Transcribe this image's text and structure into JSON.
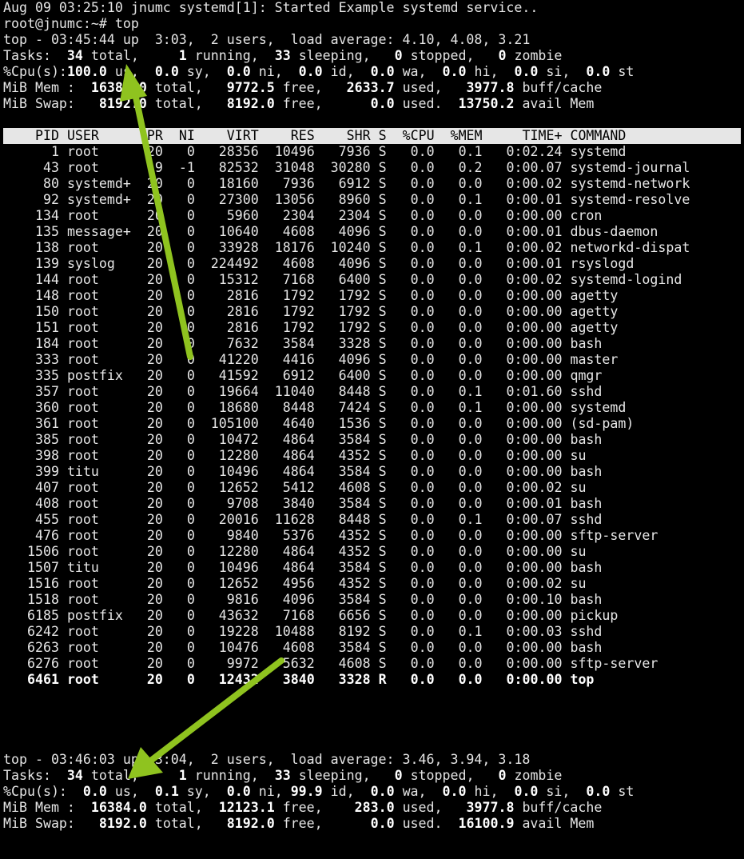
{
  "log_line": "Aug 09 03:25:10 jnumc systemd[1]: Started Example systemd service..",
  "prompt_line": "root@jnumc:~# top",
  "first": {
    "uptime": "top - 03:45:44 up  3:03,  2 users,  load average: 4.10, 4.08, 3.21",
    "tasks": {
      "total": "34",
      "running": "1",
      "sleeping": "33",
      "stopped": "0",
      "zombie": "0"
    },
    "cpu": {
      "us": "100.0",
      "sy": "0.0",
      "ni": "0.0",
      "id": "0.0",
      "wa": "0.0",
      "hi": "0.0",
      "si": "0.0",
      "st": "0.0"
    },
    "mem": {
      "total": "16384.0",
      "free": "9772.5",
      "used": "2633.7",
      "buff": "3977.8"
    },
    "swap": {
      "total": "8192.0",
      "free": "8192.0",
      "used": "0.0",
      "avail": "13750.2"
    }
  },
  "columns": {
    "pid": "PID",
    "user": "USER",
    "pr": "PR",
    "ni": "NI",
    "virt": "VIRT",
    "res": "RES",
    "shr": "SHR",
    "s": "S",
    "cpu": "%CPU",
    "mem": "%MEM",
    "time": "TIME+",
    "command": "COMMAND"
  },
  "processes": [
    [
      "1",
      "root",
      "20",
      "0",
      "28356",
      "10496",
      "7936",
      "S",
      "0.0",
      "0.1",
      "0:02.24",
      "systemd"
    ],
    [
      "43",
      "root",
      "19",
      "-1",
      "82532",
      "31048",
      "30280",
      "S",
      "0.0",
      "0.2",
      "0:00.07",
      "systemd-journal"
    ],
    [
      "80",
      "systemd+",
      "20",
      "0",
      "18160",
      "7936",
      "6912",
      "S",
      "0.0",
      "0.0",
      "0:00.02",
      "systemd-network"
    ],
    [
      "92",
      "systemd+",
      "20",
      "0",
      "27300",
      "13056",
      "8960",
      "S",
      "0.0",
      "0.1",
      "0:00.01",
      "systemd-resolve"
    ],
    [
      "134",
      "root",
      "20",
      "0",
      "5960",
      "2304",
      "2304",
      "S",
      "0.0",
      "0.0",
      "0:00.00",
      "cron"
    ],
    [
      "135",
      "message+",
      "20",
      "0",
      "10640",
      "4608",
      "4096",
      "S",
      "0.0",
      "0.0",
      "0:00.01",
      "dbus-daemon"
    ],
    [
      "138",
      "root",
      "20",
      "0",
      "33928",
      "18176",
      "10240",
      "S",
      "0.0",
      "0.1",
      "0:00.02",
      "networkd-dispat"
    ],
    [
      "139",
      "syslog",
      "20",
      "0",
      "224492",
      "4608",
      "4096",
      "S",
      "0.0",
      "0.0",
      "0:00.01",
      "rsyslogd"
    ],
    [
      "144",
      "root",
      "20",
      "0",
      "15312",
      "7168",
      "6400",
      "S",
      "0.0",
      "0.0",
      "0:00.02",
      "systemd-logind"
    ],
    [
      "148",
      "root",
      "20",
      "0",
      "2816",
      "1792",
      "1792",
      "S",
      "0.0",
      "0.0",
      "0:00.00",
      "agetty"
    ],
    [
      "150",
      "root",
      "20",
      "0",
      "2816",
      "1792",
      "1792",
      "S",
      "0.0",
      "0.0",
      "0:00.00",
      "agetty"
    ],
    [
      "151",
      "root",
      "20",
      "0",
      "2816",
      "1792",
      "1792",
      "S",
      "0.0",
      "0.0",
      "0:00.00",
      "agetty"
    ],
    [
      "184",
      "root",
      "20",
      "0",
      "7632",
      "3584",
      "3328",
      "S",
      "0.0",
      "0.0",
      "0:00.00",
      "bash"
    ],
    [
      "333",
      "root",
      "20",
      "0",
      "41220",
      "4416",
      "4096",
      "S",
      "0.0",
      "0.0",
      "0:00.00",
      "master"
    ],
    [
      "335",
      "postfix",
      "20",
      "0",
      "41592",
      "6912",
      "6400",
      "S",
      "0.0",
      "0.0",
      "0:00.00",
      "qmgr"
    ],
    [
      "357",
      "root",
      "20",
      "0",
      "19664",
      "11040",
      "8448",
      "S",
      "0.0",
      "0.1",
      "0:01.60",
      "sshd"
    ],
    [
      "360",
      "root",
      "20",
      "0",
      "18680",
      "8448",
      "7424",
      "S",
      "0.0",
      "0.1",
      "0:00.00",
      "systemd"
    ],
    [
      "361",
      "root",
      "20",
      "0",
      "105100",
      "4640",
      "1536",
      "S",
      "0.0",
      "0.0",
      "0:00.00",
      "(sd-pam)"
    ],
    [
      "385",
      "root",
      "20",
      "0",
      "10472",
      "4864",
      "3584",
      "S",
      "0.0",
      "0.0",
      "0:00.00",
      "bash"
    ],
    [
      "398",
      "root",
      "20",
      "0",
      "12280",
      "4864",
      "4352",
      "S",
      "0.0",
      "0.0",
      "0:00.00",
      "su"
    ],
    [
      "399",
      "titu",
      "20",
      "0",
      "10496",
      "4864",
      "3584",
      "S",
      "0.0",
      "0.0",
      "0:00.00",
      "bash"
    ],
    [
      "407",
      "root",
      "20",
      "0",
      "12652",
      "5412",
      "4608",
      "S",
      "0.0",
      "0.0",
      "0:00.02",
      "su"
    ],
    [
      "408",
      "root",
      "20",
      "0",
      "9708",
      "3840",
      "3584",
      "S",
      "0.0",
      "0.0",
      "0:00.01",
      "bash"
    ],
    [
      "455",
      "root",
      "20",
      "0",
      "20016",
      "11628",
      "8448",
      "S",
      "0.0",
      "0.1",
      "0:00.07",
      "sshd"
    ],
    [
      "476",
      "root",
      "20",
      "0",
      "9840",
      "5376",
      "4352",
      "S",
      "0.0",
      "0.0",
      "0:00.00",
      "sftp-server"
    ],
    [
      "1506",
      "root",
      "20",
      "0",
      "12280",
      "4864",
      "4352",
      "S",
      "0.0",
      "0.0",
      "0:00.00",
      "su"
    ],
    [
      "1507",
      "titu",
      "20",
      "0",
      "10496",
      "4864",
      "3584",
      "S",
      "0.0",
      "0.0",
      "0:00.00",
      "bash"
    ],
    [
      "1516",
      "root",
      "20",
      "0",
      "12652",
      "4956",
      "4352",
      "S",
      "0.0",
      "0.0",
      "0:00.02",
      "su"
    ],
    [
      "1518",
      "root",
      "20",
      "0",
      "9816",
      "4096",
      "3584",
      "S",
      "0.0",
      "0.0",
      "0:00.10",
      "bash"
    ],
    [
      "6185",
      "postfix",
      "20",
      "0",
      "43632",
      "7168",
      "6656",
      "S",
      "0.0",
      "0.0",
      "0:00.00",
      "pickup"
    ],
    [
      "6242",
      "root",
      "20",
      "0",
      "19228",
      "10488",
      "8192",
      "S",
      "0.0",
      "0.1",
      "0:00.03",
      "sshd"
    ],
    [
      "6263",
      "root",
      "20",
      "0",
      "10476",
      "4608",
      "3584",
      "S",
      "0.0",
      "0.0",
      "0:00.00",
      "bash"
    ],
    [
      "6276",
      "root",
      "20",
      "0",
      "9972",
      "5632",
      "4608",
      "S",
      "0.0",
      "0.0",
      "0:00.00",
      "sftp-server"
    ],
    [
      "6461",
      "root",
      "20",
      "0",
      "12432",
      "3840",
      "3328",
      "R",
      "0.0",
      "0.0",
      "0:00.00",
      "top"
    ]
  ],
  "second": {
    "uptime": "top - 03:46:03 up  3:04,  2 users,  load average: 3.46, 3.94, 3.18",
    "tasks": {
      "total": "34",
      "running": "1",
      "sleeping": "33",
      "stopped": "0",
      "zombie": "0"
    },
    "cpu": {
      "us": "0.0",
      "sy": "0.1",
      "ni": "0.0",
      "id": "99.9",
      "wa": "0.0",
      "hi": "0.0",
      "si": "0.0",
      "st": "0.0"
    },
    "mem": {
      "total": "16384.0",
      "free": "12123.1",
      "used": "283.0",
      "buff": "3977.8"
    },
    "swap": {
      "total": "8192.0",
      "free": "8192.0",
      "used": "0.0",
      "avail": "16100.9"
    }
  },
  "colors": {
    "arrow": "#8fc31f",
    "text": "#e6e6e6",
    "header_bg": "#e6e6e6"
  }
}
